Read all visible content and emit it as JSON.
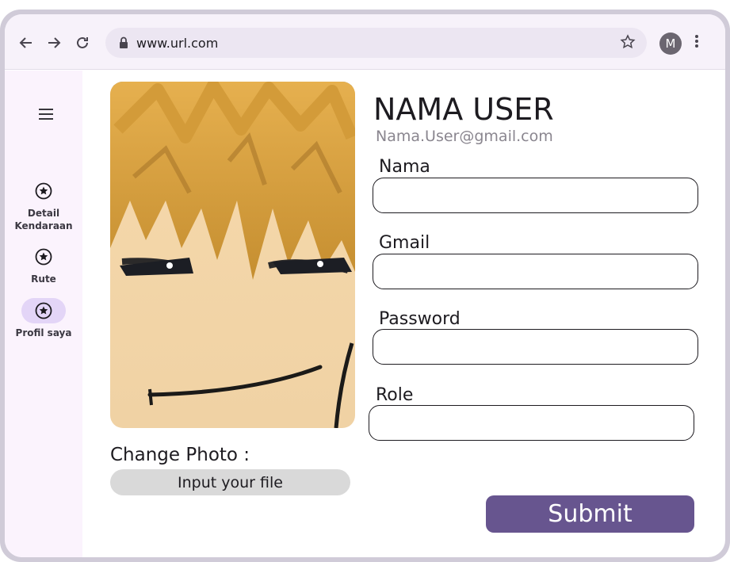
{
  "browser": {
    "url": "www.url.com",
    "profile_initial": "M"
  },
  "rail": {
    "items": [
      {
        "label": "Detail Kendaraan",
        "icon": "star-circle-icon",
        "active": false
      },
      {
        "label": "Rute",
        "icon": "star-circle-icon",
        "active": false
      },
      {
        "label": "Profil saya",
        "icon": "star-circle-icon",
        "active": true
      }
    ]
  },
  "profile": {
    "name": "NAMA USER",
    "email": "Nama.User@gmail.com",
    "change_photo_label": "Change Photo :",
    "file_button_label": "Input your file"
  },
  "form": {
    "fields": [
      {
        "label": "Nama",
        "value": ""
      },
      {
        "label": "Gmail",
        "value": ""
      },
      {
        "label": "Password",
        "value": ""
      },
      {
        "label": "Role",
        "value": ""
      }
    ],
    "submit_label": "Submit"
  },
  "colors": {
    "accent": "#67558f",
    "rail_active": "#e3d5f7",
    "rail_bg": "#fbf3fd",
    "frame": "#d0cbd8"
  }
}
